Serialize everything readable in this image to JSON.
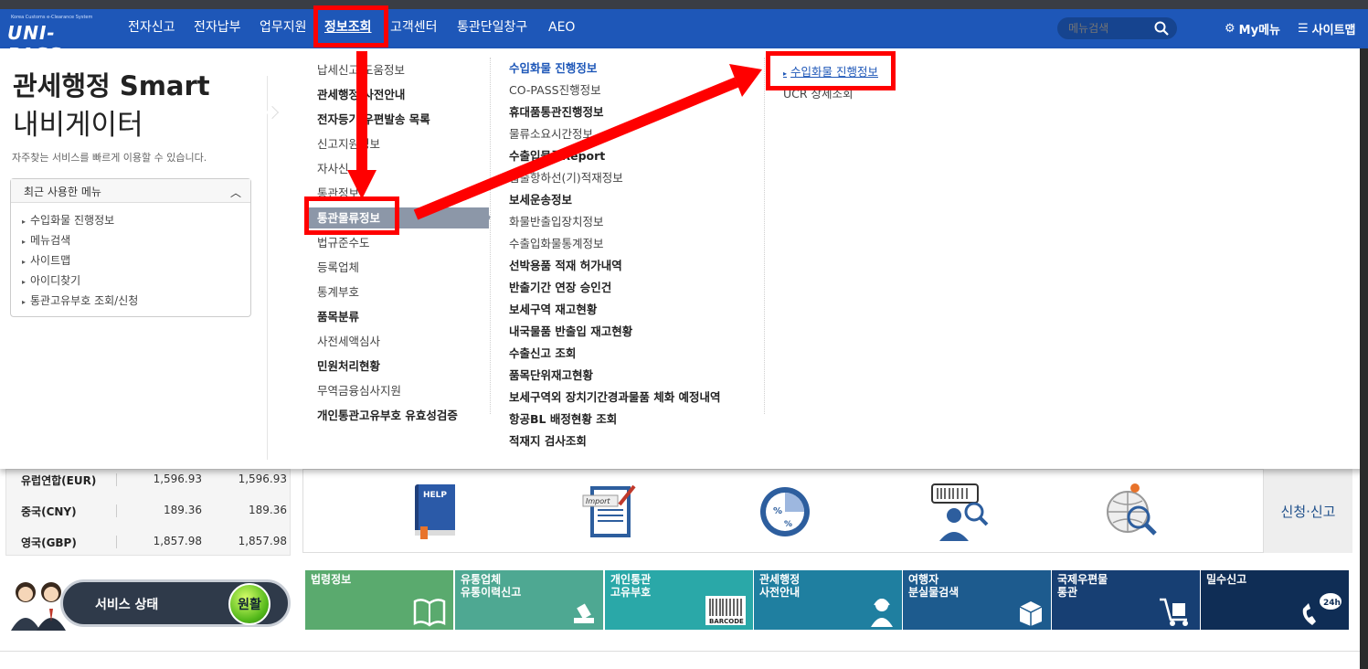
{
  "header": {
    "logo_small": "Korea Customs e-Clearance System",
    "logo_big": "UNI-PASS",
    "gnb": [
      "전자신고",
      "전자납부",
      "업무지원",
      "정보조회",
      "고객센터",
      "통관단일창구",
      "AEO"
    ],
    "search_placeholder": "메뉴검색",
    "my_menu": "My메뉴",
    "sitemap": "사이트맵"
  },
  "navigator": {
    "title_bold": "관세행정 Smart",
    "title_light": "내비게이터",
    "description": "자주찾는 서비스를 빠르게 이용할 수 있습니다.",
    "recent_head": "최근 사용한 메뉴",
    "recent_items": [
      "수입화물 진행정보",
      "메뉴검색",
      "사이트맵",
      "아이디찾기",
      "통관고유부호 조회/신청"
    ]
  },
  "menu": {
    "col1": [
      {
        "label": "납세신고 도움정보",
        "bold": false
      },
      {
        "label": "관세행정 사전안내",
        "bold": true
      },
      {
        "label": "전자등기 우편발송 목록",
        "bold": true
      },
      {
        "label": "신고지원정보",
        "bold": false
      },
      {
        "label": "자사신",
        "bold": false
      },
      {
        "label": "통관정보",
        "bold": false
      },
      {
        "label": "통관물류정보",
        "bold": false
      },
      {
        "label": "법규준수도",
        "bold": false
      },
      {
        "label": "등록업체",
        "bold": false
      },
      {
        "label": "통계부호",
        "bold": false
      },
      {
        "label": "품목분류",
        "bold": true
      },
      {
        "label": "사전세액심사",
        "bold": false
      },
      {
        "label": "민원처리현황",
        "bold": true
      },
      {
        "label": "무역금융심사지원",
        "bold": false
      },
      {
        "label": "개인통관고유부호 유효성검증",
        "bold": true
      }
    ],
    "col2": [
      {
        "label": "수입화물 진행정보",
        "kind": "head"
      },
      {
        "label": "CO-PASS진행정보",
        "kind": ""
      },
      {
        "label": "휴대품통관진행정보",
        "kind": "b"
      },
      {
        "label": "물류소요시간정보",
        "kind": ""
      },
      {
        "label": "수출입물류Report",
        "kind": "b"
      },
      {
        "label": "입출항하선(기)적재정보",
        "kind": ""
      },
      {
        "label": "보세운송정보",
        "kind": "b"
      },
      {
        "label": "화물반출입장치정보",
        "kind": ""
      },
      {
        "label": "수출입화물통계정보",
        "kind": ""
      },
      {
        "label": "선박용품 적재 허가내역",
        "kind": "b"
      },
      {
        "label": "반출기간 연장 승인건",
        "kind": "b"
      },
      {
        "label": "보세구역 재고현황",
        "kind": "b"
      },
      {
        "label": "내국물품 반출입 재고현황",
        "kind": "b"
      },
      {
        "label": "수출신고 조회",
        "kind": "b"
      },
      {
        "label": "품목단위재고현황",
        "kind": "b"
      },
      {
        "label": "보세구역외 장치기간경과물품 체화 예정내역",
        "kind": "b"
      },
      {
        "label": "항공BL 배정현황 조회",
        "kind": "b"
      },
      {
        "label": "적재지 검사조회",
        "kind": "b"
      }
    ],
    "col3": [
      "수입화물 진행정보",
      "UCR 상세조회"
    ]
  },
  "exchange": [
    {
      "currency": "유럽연합(EUR)",
      "v1": "1,596.93",
      "v2": "1,596.93"
    },
    {
      "currency": "중국(CNY)",
      "v1": "189.36",
      "v2": "189.36"
    },
    {
      "currency": "영국(GBP)",
      "v1": "1,857.98",
      "v2": "1,857.98"
    }
  ],
  "icons": {
    "help_text": "HELP",
    "import_text": "Import",
    "apply": "신청·신고"
  },
  "status": {
    "label": "서비스 상태",
    "value": "원활"
  },
  "tiles": [
    {
      "label": "법령정보",
      "color": "#5aaa6e",
      "icon": "book-icon"
    },
    {
      "label": "유통업체\n유통이력신고",
      "color": "#4ea892",
      "icon": "stamp-icon"
    },
    {
      "label": "개인통관\n고유부호",
      "color": "#2aa8a8",
      "icon": "barcode-icon",
      "sub": "BARCODE"
    },
    {
      "label": "관세행정\n사전안내",
      "color": "#1f7fa0",
      "icon": "agent-icon"
    },
    {
      "label": "여행자\n분실물검색",
      "color": "#1d5b8e",
      "icon": "box-icon"
    },
    {
      "label": "국제우편물\n통관",
      "color": "#173f73",
      "icon": "cart-icon"
    },
    {
      "label": "밀수신고",
      "color": "#0f2d55",
      "icon": "phone-icon",
      "sub": "24h"
    }
  ]
}
